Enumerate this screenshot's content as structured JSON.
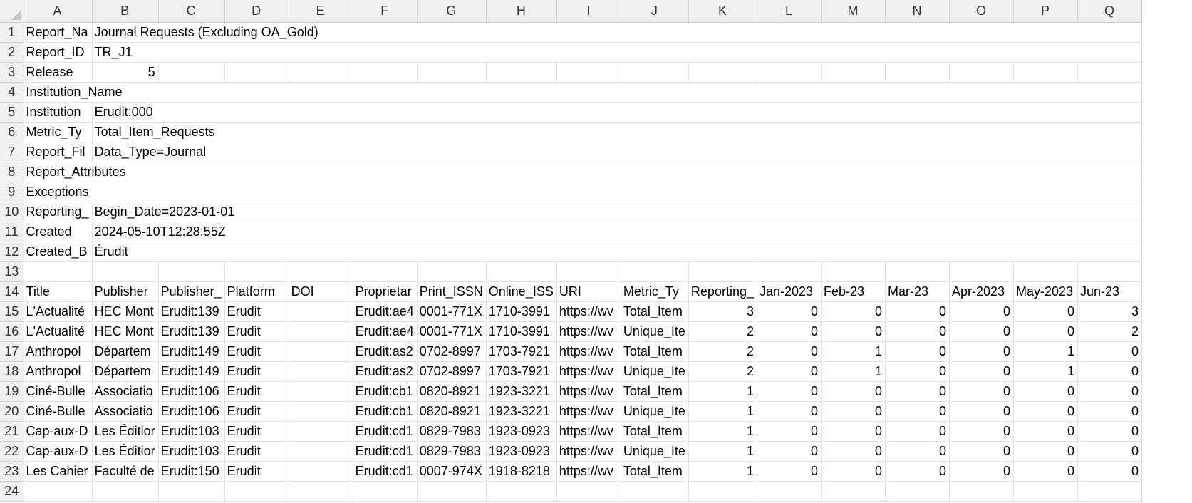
{
  "columns": [
    "A",
    "B",
    "C",
    "D",
    "E",
    "F",
    "G",
    "H",
    "I",
    "J",
    "K",
    "L",
    "M",
    "N",
    "O",
    "P",
    "Q"
  ],
  "rows": [
    {
      "n": "1",
      "cells": [
        "Report_Na",
        "Journal Requests (Excluding OA_Gold)",
        "",
        "",
        "",
        "",
        "",
        "",
        "",
        "",
        "",
        "",
        "",
        "",
        "",
        "",
        ""
      ]
    },
    {
      "n": "2",
      "cells": [
        "Report_ID",
        "TR_J1",
        "",
        "",
        "",
        "",
        "",
        "",
        "",
        "",
        "",
        "",
        "",
        "",
        "",
        "",
        ""
      ]
    },
    {
      "n": "3",
      "cells": [
        "Release",
        "5",
        "",
        "",
        "",
        "",
        "",
        "",
        "",
        "",
        "",
        "",
        "",
        "",
        "",
        "",
        ""
      ]
    },
    {
      "n": "4",
      "cells": [
        "Institution_Name",
        "",
        "",
        "",
        "",
        "",
        "",
        "",
        "",
        "",
        "",
        "",
        "",
        "",
        "",
        "",
        ""
      ]
    },
    {
      "n": "5",
      "cells": [
        "Institution",
        "Erudit:000",
        "",
        "",
        "",
        "",
        "",
        "",
        "",
        "",
        "",
        "",
        "",
        "",
        "",
        "",
        ""
      ]
    },
    {
      "n": "6",
      "cells": [
        "Metric_Ty",
        "Total_Item_Requests",
        "",
        "",
        "",
        "",
        "",
        "",
        "",
        "",
        "",
        "",
        "",
        "",
        "",
        "",
        ""
      ]
    },
    {
      "n": "7",
      "cells": [
        "Report_Fil",
        "Data_Type=Journal",
        "",
        "",
        "",
        "",
        "",
        "",
        "",
        "",
        "",
        "",
        "",
        "",
        "",
        "",
        ""
      ]
    },
    {
      "n": "8",
      "cells": [
        "Report_Attributes",
        "",
        "",
        "",
        "",
        "",
        "",
        "",
        "",
        "",
        "",
        "",
        "",
        "",
        "",
        "",
        ""
      ]
    },
    {
      "n": "9",
      "cells": [
        "Exceptions",
        "",
        "",
        "",
        "",
        "",
        "",
        "",
        "",
        "",
        "",
        "",
        "",
        "",
        "",
        "",
        ""
      ]
    },
    {
      "n": "10",
      "cells": [
        "Reporting_",
        "Begin_Date=2023-01-01",
        "",
        "",
        "",
        "",
        "",
        "",
        "",
        "",
        "",
        "",
        "",
        "",
        "",
        "",
        ""
      ]
    },
    {
      "n": "11",
      "cells": [
        "Created",
        "2024-05-10T12:28:55Z",
        "",
        "",
        "",
        "",
        "",
        "",
        "",
        "",
        "",
        "",
        "",
        "",
        "",
        "",
        ""
      ]
    },
    {
      "n": "12",
      "cells": [
        "Created_B",
        "Érudit",
        "",
        "",
        "",
        "",
        "",
        "",
        "",
        "",
        "",
        "",
        "",
        "",
        "",
        "",
        ""
      ]
    },
    {
      "n": "13",
      "cells": [
        "",
        "",
        "",
        "",
        "",
        "",
        "",
        "",
        "",
        "",
        "",
        "",
        "",
        "",
        "",
        "",
        ""
      ]
    },
    {
      "n": "14",
      "cells": [
        "Title",
        "Publisher",
        "Publisher_",
        "Platform",
        "DOI",
        "Proprietar",
        "Print_ISSN",
        "Online_ISS",
        "URI",
        "Metric_Ty",
        "Reporting_",
        "Jan-2023",
        "Feb-23",
        "Mar-23",
        "Apr-2023",
        "May-2023",
        "Jun-23"
      ]
    },
    {
      "n": "15",
      "cells": [
        "L'Actualité",
        "HEC Mont",
        "Erudit:139",
        "Erudit",
        "",
        "Erudit:ae4",
        "0001-771X",
        "1710-3991",
        "https://wv",
        "Total_Item",
        "3",
        "0",
        "0",
        "0",
        "0",
        "0",
        "3"
      ]
    },
    {
      "n": "16",
      "cells": [
        "L'Actualité",
        "HEC Mont",
        "Erudit:139",
        "Erudit",
        "",
        "Erudit:ae4",
        "0001-771X",
        "1710-3991",
        "https://wv",
        "Unique_Ite",
        "2",
        "0",
        "0",
        "0",
        "0",
        "0",
        "2"
      ]
    },
    {
      "n": "17",
      "cells": [
        "Anthropol",
        "Départem",
        "Erudit:149",
        "Erudit",
        "",
        "Erudit:as2",
        "0702-8997",
        "1703-7921",
        "https://wv",
        "Total_Item",
        "2",
        "0",
        "1",
        "0",
        "0",
        "1",
        "0"
      ]
    },
    {
      "n": "18",
      "cells": [
        "Anthropol",
        "Départem",
        "Erudit:149",
        "Erudit",
        "",
        "Erudit:as2",
        "0702-8997",
        "1703-7921",
        "https://wv",
        "Unique_Ite",
        "2",
        "0",
        "1",
        "0",
        "0",
        "1",
        "0"
      ]
    },
    {
      "n": "19",
      "cells": [
        "Ciné-Bulle",
        "Associatio",
        "Erudit:106",
        "Erudit",
        "",
        "Erudit:cb1",
        "0820-8921",
        "1923-3221",
        "https://wv",
        "Total_Item",
        "1",
        "0",
        "0",
        "0",
        "0",
        "0",
        "0"
      ]
    },
    {
      "n": "20",
      "cells": [
        "Ciné-Bulle",
        "Associatio",
        "Erudit:106",
        "Erudit",
        "",
        "Erudit:cb1",
        "0820-8921",
        "1923-3221",
        "https://wv",
        "Unique_Ite",
        "1",
        "0",
        "0",
        "0",
        "0",
        "0",
        "0"
      ]
    },
    {
      "n": "21",
      "cells": [
        "Cap-aux-D",
        "Les Éditior",
        "Erudit:103",
        "Erudit",
        "",
        "Erudit:cd1",
        "0829-7983",
        "1923-0923",
        "https://wv",
        "Total_Item",
        "1",
        "0",
        "0",
        "0",
        "0",
        "0",
        "0"
      ]
    },
    {
      "n": "22",
      "cells": [
        "Cap-aux-D",
        "Les Éditior",
        "Erudit:103",
        "Erudit",
        "",
        "Erudit:cd1",
        "0829-7983",
        "1923-0923",
        "https://wv",
        "Unique_Ite",
        "1",
        "0",
        "0",
        "0",
        "0",
        "0",
        "0"
      ]
    },
    {
      "n": "23",
      "cells": [
        "Les Cahier",
        "Faculté de",
        "Erudit:150",
        "Erudit",
        "",
        "Erudit:cd1",
        "0007-974X",
        "1918-8218",
        "https://wv",
        "Total_Item",
        "1",
        "0",
        "0",
        "0",
        "0",
        "0",
        "0"
      ]
    },
    {
      "n": "24",
      "cells": [
        "",
        "",
        "",
        "",
        "",
        "",
        "",
        "",
        "",
        "",
        "",
        "",
        "",
        "",
        "",
        "",
        ""
      ]
    }
  ]
}
